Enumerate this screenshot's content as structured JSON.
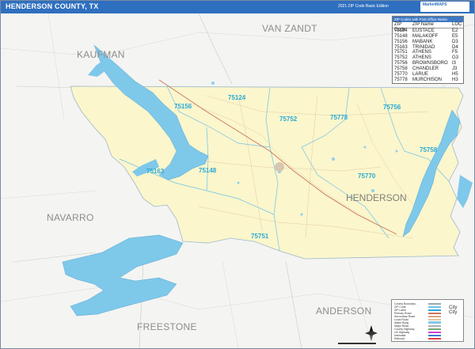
{
  "header": {
    "title": "HENDERSON COUNTY, TX",
    "subtitle": "2021 ZIP Code Basic Edition",
    "logo": "MarketMAPS"
  },
  "counties": {
    "van_zandt": "VAN ZANDT",
    "kaufman": "KAUFMAN",
    "navarro": "NAVARRO",
    "freestone": "FREESTONE",
    "anderson": "ANDERSON",
    "henderson": "HENDERSON"
  },
  "map_zip_labels": [
    "75156",
    "75124",
    "75752",
    "75778",
    "75756",
    "75758",
    "75163",
    "75148",
    "75770",
    "75751"
  ],
  "zip_table": {
    "caption": "ZIP Codes with Post Office Name",
    "headers": [
      "ZIP Code",
      "ZIP Name",
      "LOC"
    ],
    "rows": [
      [
        "75124",
        "EUSTACE",
        "E2"
      ],
      [
        "75148",
        "MALAKOFF",
        "E5"
      ],
      [
        "75156",
        "MABANK",
        "D3"
      ],
      [
        "75163",
        "TRINIDAD",
        "D4"
      ],
      [
        "75751",
        "ATHENS",
        "F5"
      ],
      [
        "75752",
        "ATHENS",
        "G3"
      ],
      [
        "75756",
        "BROWNSBORO",
        "I3"
      ],
      [
        "75758",
        "CHANDLER",
        "J3"
      ],
      [
        "75770",
        "LARUE",
        "H5"
      ],
      [
        "75778",
        "MURCHISON",
        "H3"
      ]
    ]
  },
  "legend": {
    "items": [
      "County Boundary",
      "ZIP Code",
      "ZIP Label",
      "Primary Road",
      "Secondary Road",
      "Local Road",
      "Water Body",
      "Major Road",
      "County Highway",
      "US Highway",
      "Interstate",
      "Railroad"
    ],
    "city_key": [
      "City",
      "City"
    ]
  },
  "colors": {
    "header": "#2f6fbf",
    "county_fill": "#fbf6cc",
    "water": "#7ec8ea",
    "zip_label": "#2aa9d6",
    "background": "#f4f4f2"
  }
}
